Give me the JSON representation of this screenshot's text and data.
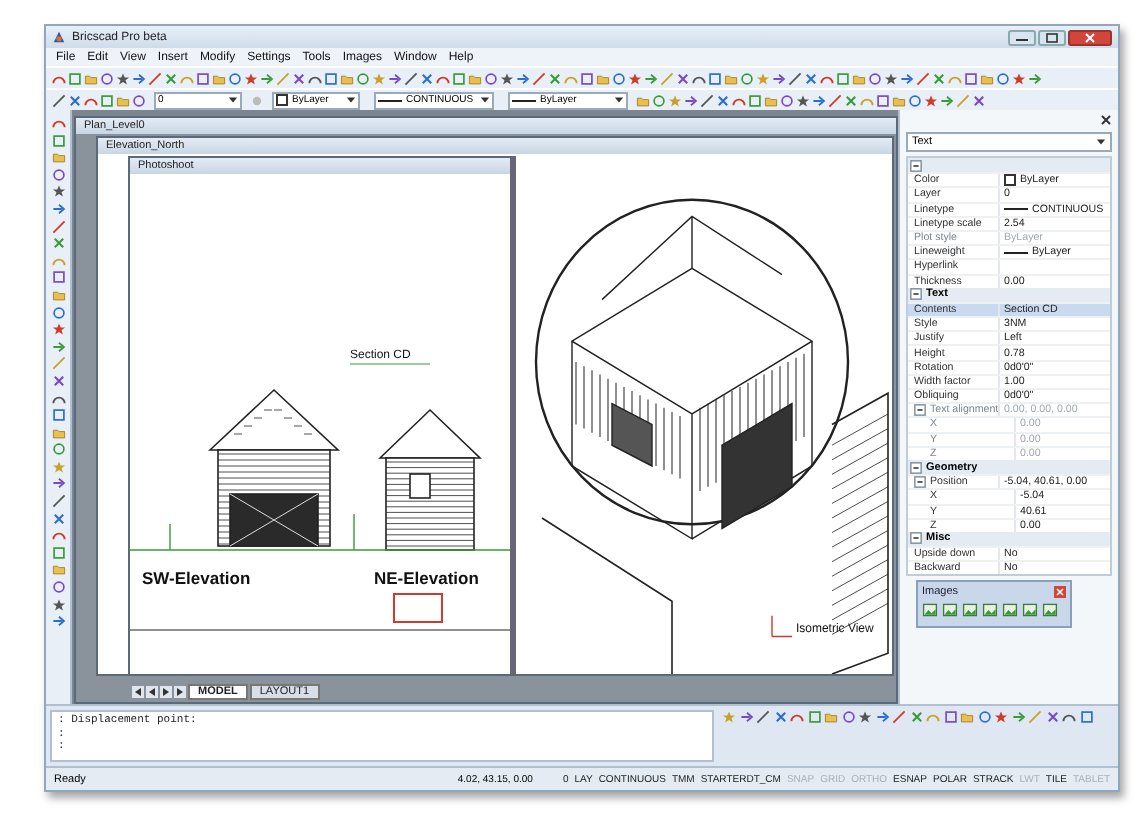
{
  "window": {
    "title": "Bricscad Pro beta"
  },
  "menu": [
    "File",
    "Edit",
    "View",
    "Insert",
    "Modify",
    "Settings",
    "Tools",
    "Images",
    "Window",
    "Help"
  ],
  "layer_bar": {
    "layer": "0",
    "color_setting": "ByLayer",
    "linetype": "CONTINUOUS",
    "lineweight": "ByLayer"
  },
  "documents": [
    {
      "title": "Plan_Level0"
    },
    {
      "title": "Elevation_North"
    },
    {
      "title": "Photoshoot"
    }
  ],
  "drawing": {
    "labels": [
      "Section CD",
      "SW-Elevation",
      "NE-Elevation",
      "Isometric View"
    ]
  },
  "layout_tabs": [
    {
      "label": "MODEL",
      "selected": true
    },
    {
      "label": "LAYOUT1",
      "selected": false
    }
  ],
  "properties": {
    "object_type": "Text",
    "groups": [
      {
        "expanded": true,
        "rows": [
          {
            "label": "Color",
            "value": "ByLayer",
            "kind": "swatch",
            "selected": false,
            "disabled": false
          },
          {
            "label": "Layer",
            "value": "0",
            "kind": "text",
            "selected": false,
            "disabled": false
          },
          {
            "label": "Linetype",
            "value": "CONTINUOUS",
            "kind": "line",
            "selected": false,
            "disabled": false
          },
          {
            "label": "Linetype scale",
            "value": "2.54",
            "kind": "text",
            "selected": false,
            "disabled": false
          },
          {
            "label": "Plot style",
            "value": "ByLayer",
            "kind": "text",
            "selected": false,
            "disabled": true
          },
          {
            "label": "Lineweight",
            "value": "ByLayer",
            "kind": "line",
            "selected": false,
            "disabled": false
          },
          {
            "label": "Hyperlink",
            "kind": "text",
            "selected": false,
            "disabled": false
          },
          {
            "label": "Thickness",
            "value": "0.00",
            "kind": "text",
            "selected": false,
            "disabled": false
          }
        ]
      },
      {
        "title": "Text",
        "expanded": true,
        "rows": [
          {
            "label": "Contents",
            "value": "Section CD",
            "kind": "text",
            "selected": true,
            "disabled": false
          },
          {
            "label": "Style",
            "value": "3NM",
            "kind": "text",
            "selected": false,
            "disabled": false
          },
          {
            "label": "Justify",
            "value": "Left",
            "kind": "text",
            "selected": false,
            "disabled": false
          },
          {
            "label": "Height",
            "value": "0.78",
            "kind": "text",
            "selected": false,
            "disabled": false
          },
          {
            "label": "Rotation",
            "value": "0d0'0\"",
            "kind": "text",
            "selected": false,
            "disabled": false
          },
          {
            "label": "Width factor",
            "value": "1.00",
            "kind": "text",
            "selected": false,
            "disabled": false
          },
          {
            "label": "Obliquing",
            "value": "0d0'0\"",
            "kind": "text",
            "selected": false,
            "disabled": false
          },
          {
            "label": "Text alignment",
            "value": "0.00, 0.00, 0.00",
            "kind": "text",
            "selected": false,
            "disabled": true,
            "expanded": true,
            "children": [
              {
                "label": "X",
                "value": "0.00",
                "kind": "text",
                "selected": false,
                "disabled": true
              },
              {
                "label": "Y",
                "value": "0.00",
                "kind": "text",
                "selected": false,
                "disabled": true
              },
              {
                "label": "Z",
                "value": "0.00",
                "kind": "text",
                "selected": false,
                "disabled": true
              }
            ]
          }
        ]
      },
      {
        "title": "Geometry",
        "expanded": true,
        "rows": [
          {
            "label": "Position",
            "value": "-5.04, 40.61, 0.00",
            "kind": "text",
            "selected": false,
            "disabled": false,
            "expanded": true,
            "children": [
              {
                "label": "X",
                "value": "-5.04",
                "kind": "text",
                "selected": false,
                "disabled": false
              },
              {
                "label": "Y",
                "value": "40.61",
                "kind": "text",
                "selected": false,
                "disabled": false
              },
              {
                "label": "Z",
                "value": "0.00",
                "kind": "text",
                "selected": false,
                "disabled": false
              }
            ]
          }
        ]
      },
      {
        "title": "Misc",
        "expanded": true,
        "rows": [
          {
            "label": "Upside down",
            "value": "No",
            "kind": "text",
            "selected": false,
            "disabled": false
          },
          {
            "label": "Backward",
            "value": "No",
            "kind": "text",
            "selected": false,
            "disabled": false
          }
        ]
      }
    ]
  },
  "images_toolbar": {
    "title": "Images"
  },
  "command": {
    "lines": [
      ": Displacement point:",
      ":",
      ":"
    ]
  },
  "status": {
    "message": "Ready",
    "coordinates": "4.02, 43.15, 0.00",
    "items": [
      {
        "label": "0",
        "on": true
      },
      {
        "label": "LAY",
        "on": true
      },
      {
        "label": "CONTINUOUS",
        "on": true
      },
      {
        "label": "TMM",
        "on": true
      },
      {
        "label": "STARTERDT_CM",
        "on": true
      },
      {
        "label": "SNAP",
        "on": false
      },
      {
        "label": "GRID",
        "on": false
      },
      {
        "label": "ORTHO",
        "on": false
      },
      {
        "label": "ESNAP",
        "on": true
      },
      {
        "label": "POLAR",
        "on": true
      },
      {
        "label": "STRACK",
        "on": true
      },
      {
        "label": "LWT",
        "on": false
      },
      {
        "label": "TILE",
        "on": true
      },
      {
        "label": "TABLET",
        "on": false
      }
    ]
  }
}
